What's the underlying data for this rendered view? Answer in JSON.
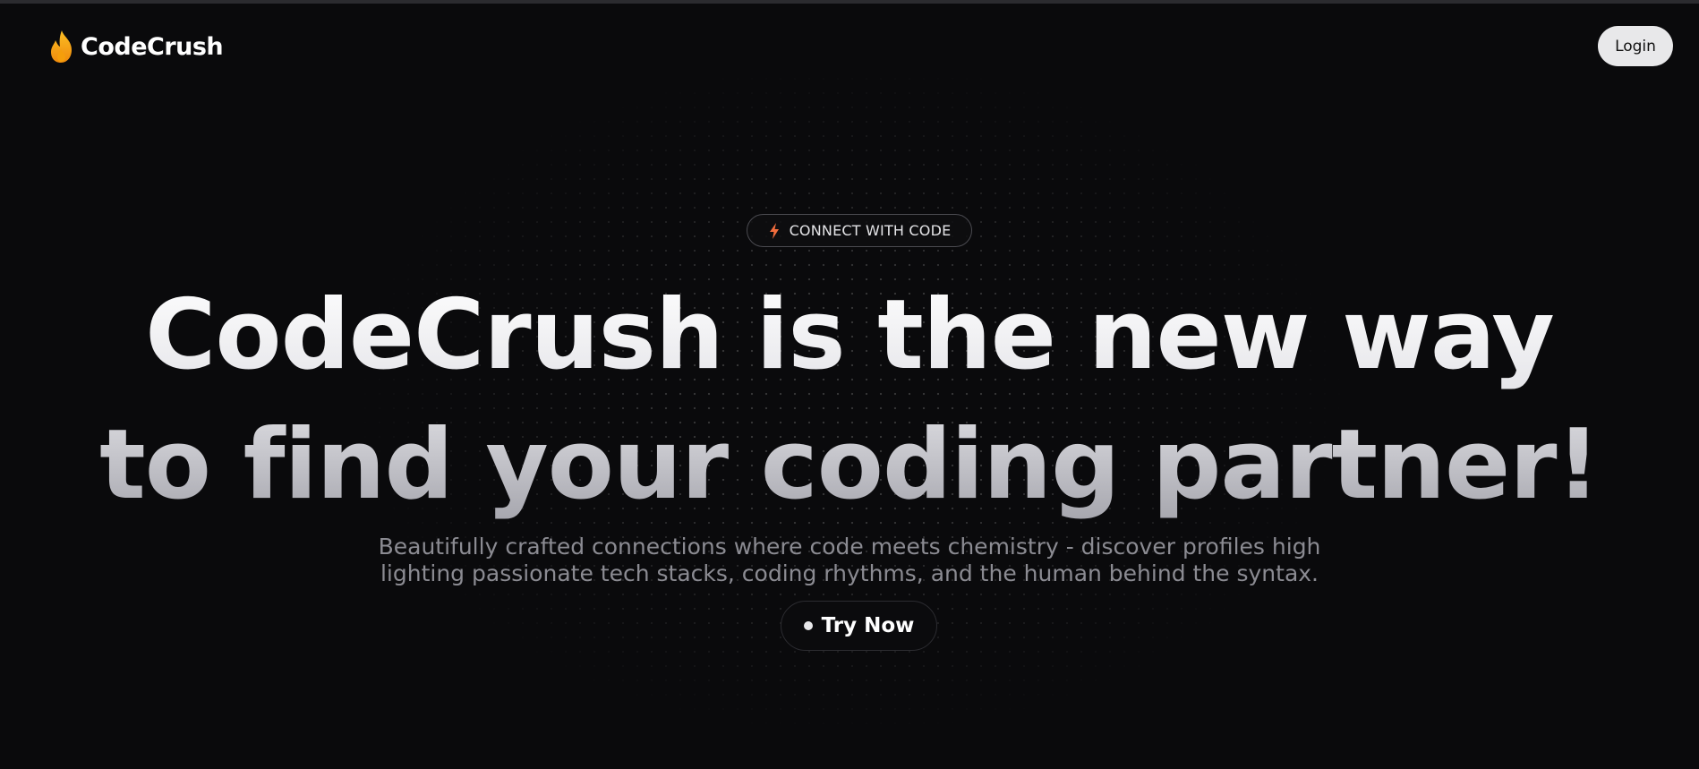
{
  "colors": {
    "background": "#0a0a0c",
    "accent_flame": "#f59e0b",
    "text_primary": "#ffffff",
    "text_muted": "#8b8b92",
    "login_bg": "#e8e8ea"
  },
  "navbar": {
    "brand_icon": "flame-icon",
    "brand_name": "CodeCrush",
    "login_label": "Login"
  },
  "hero": {
    "badge_icon": "lightning-bolt-icon",
    "badge_text": "CONNECT WITH CODE",
    "headline_line1": "CodeCrush is the new way",
    "headline_line2": "to find your coding partner!",
    "subtitle_line1": "Beautifully crafted connections where code meets chemistry - discover profiles high",
    "subtitle_line2": "lighting passionate tech stacks, coding rhythms, and the human behind the syntax.",
    "cta_icon": "dot-icon",
    "cta_label": "Try Now"
  }
}
